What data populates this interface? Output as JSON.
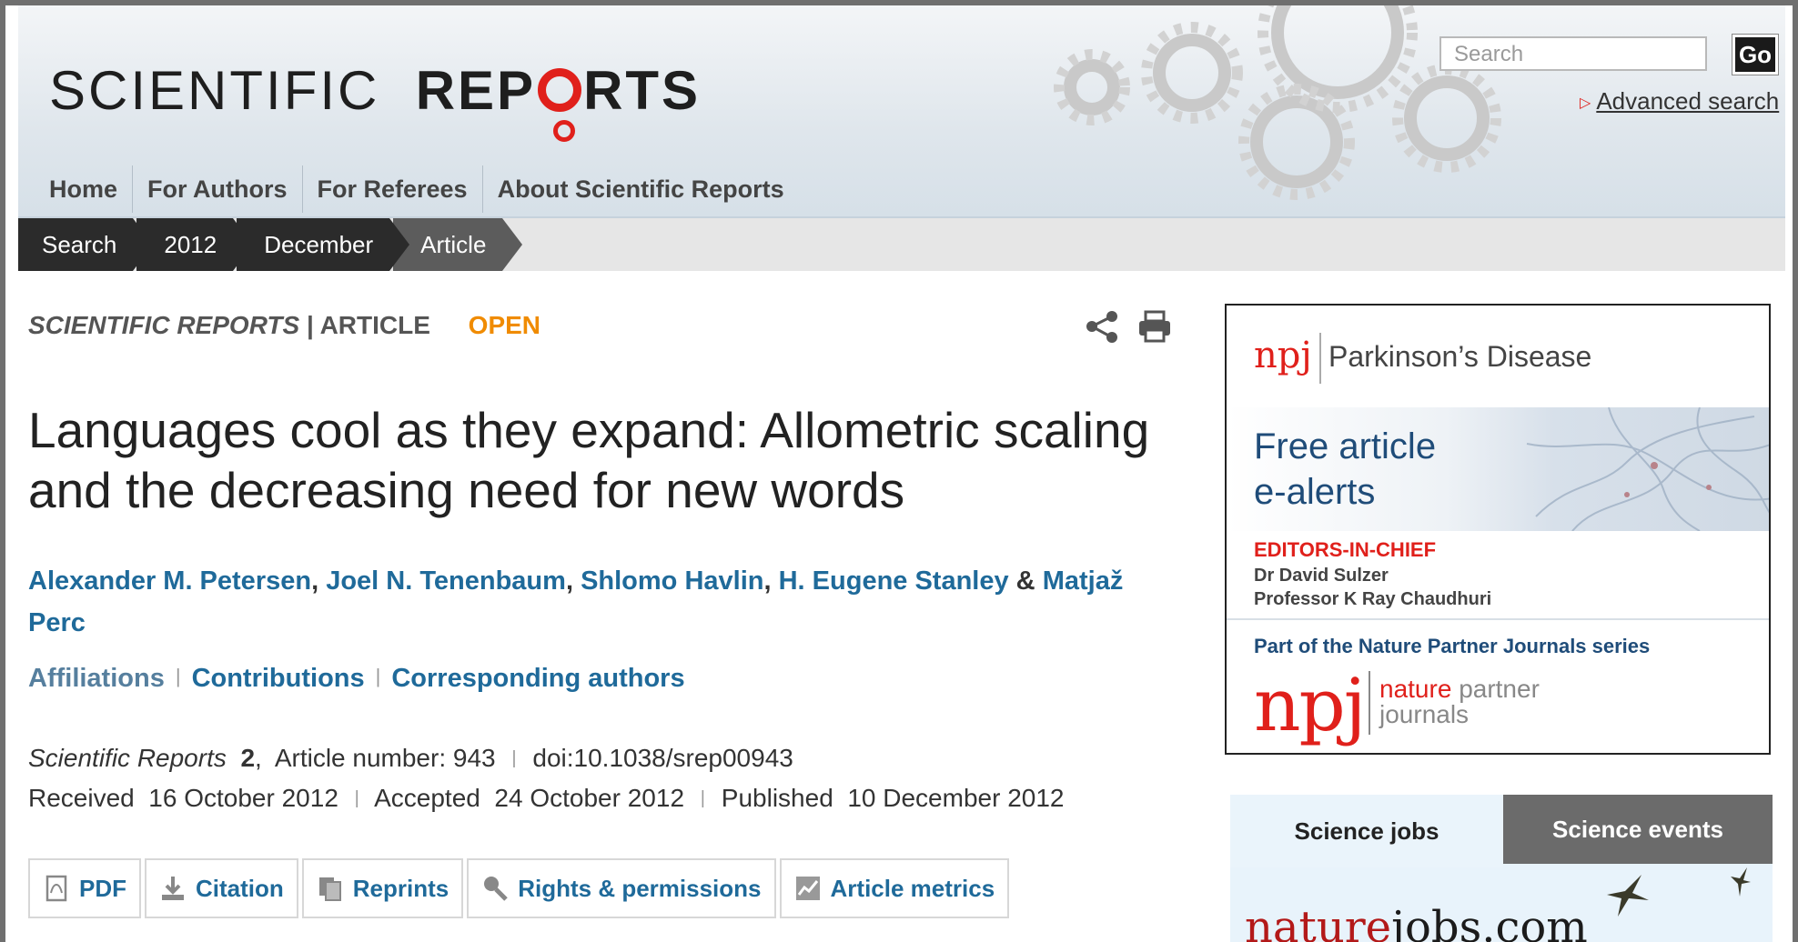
{
  "header": {
    "logo_light": "SCIENTIFIC",
    "logo_bold_1": "REP",
    "logo_bold_2": "RTS",
    "search_placeholder": "Search",
    "go_label": "Go",
    "advanced_search": "Advanced search"
  },
  "nav": [
    "Home",
    "For Authors",
    "For Referees",
    "About Scientific Reports"
  ],
  "breadcrumb": [
    "Search",
    "2012",
    "December",
    "Article"
  ],
  "article": {
    "journal": "SCIENTIFIC REPORTS",
    "separator": "|",
    "type": "ARTICLE",
    "access": "OPEN",
    "title": "Languages cool as they expand: Allometric scaling and the decreasing need for new words",
    "authors": [
      "Alexander M. Petersen",
      "Joel N. Tenenbaum",
      "Shlomo Havlin",
      "H. Eugene Stanley",
      "Matjaž Perc"
    ],
    "author_sep": ", ",
    "author_and": " & ",
    "links": [
      "Affiliations",
      "Contributions",
      "Corresponding authors"
    ],
    "citation": {
      "journal": "Scientific Reports",
      "volume": "2",
      "article_number": "Article number: 943",
      "doi": "doi:10.1038/srep00943"
    },
    "dates": {
      "received_label": "Received",
      "received": "16 October 2012",
      "accepted_label": "Accepted",
      "accepted": "24 October 2012",
      "published_label": "Published",
      "published": "10 December 2012"
    },
    "tools": [
      {
        "label": "PDF",
        "icon": "pdf-icon"
      },
      {
        "label": "Citation",
        "icon": "download-icon"
      },
      {
        "label": "Reprints",
        "icon": "reprints-icon"
      },
      {
        "label": "Rights & permissions",
        "icon": "magnifier-icon"
      },
      {
        "label": "Article metrics",
        "icon": "metrics-icon"
      }
    ]
  },
  "ad": {
    "npj_small": "npj",
    "journal": "Parkinson’s Disease",
    "headline_1": "Free article",
    "headline_2": "e-alerts",
    "eic_label": "EDITORS-IN-CHIEF",
    "editor_1": "Dr David Sulzer",
    "editor_2": "Professor K Ray Chaudhuri",
    "series": "Part of the Nature Partner Journals series",
    "npj_big": "npj",
    "nature": "nature",
    "partner": "partner",
    "journals": "journals"
  },
  "jobs_tabs": {
    "jobs": "Science jobs",
    "events": "Science events",
    "brand_red": "nature",
    "brand_dark": "jobs.com"
  },
  "colors": {
    "link_blue": "#1f6a9a",
    "open_orange": "#f08b00",
    "brand_red": "#e0201b"
  }
}
